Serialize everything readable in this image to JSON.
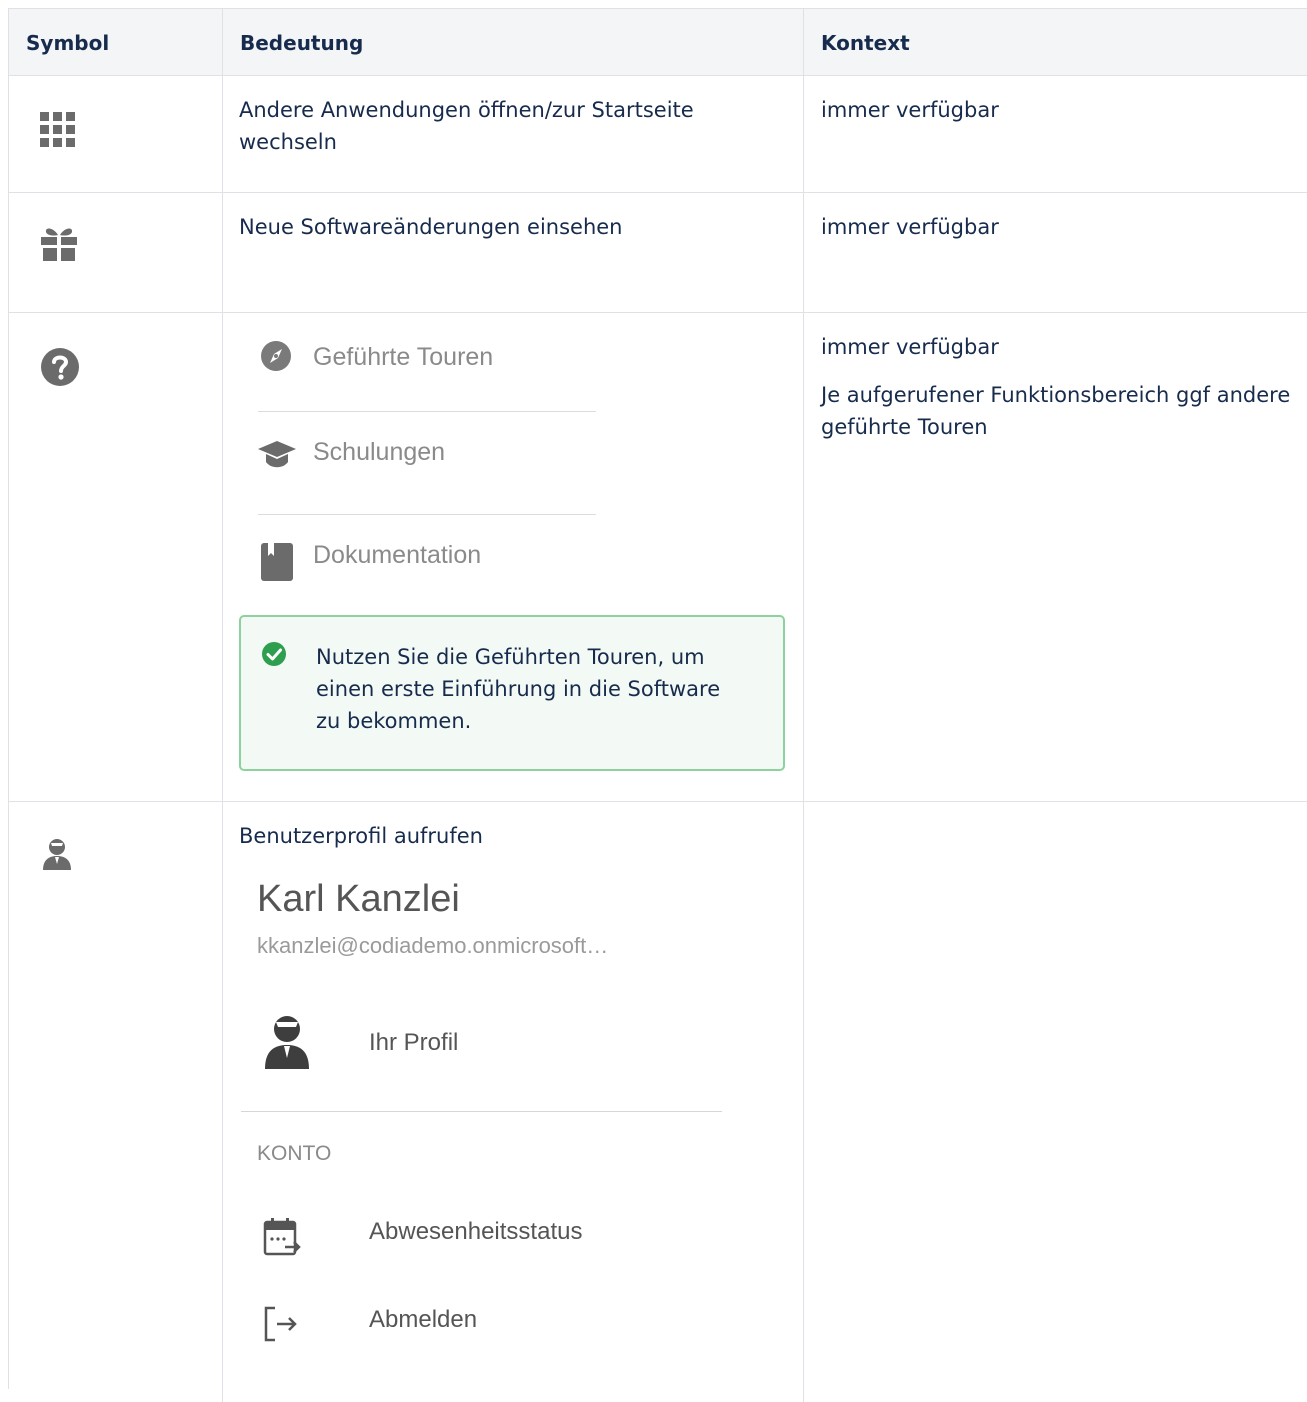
{
  "table": {
    "headers": [
      "Symbol",
      "Bedeutung",
      "Kontext"
    ],
    "rows": [
      {
        "symbol_icon": "apps-grid-icon",
        "meaning": "Andere Anwendungen öffnen/zur Startseite wechseln",
        "context": "immer verfügbar"
      },
      {
        "symbol_icon": "gift-icon",
        "meaning": "Neue Softwareänderungen einsehen",
        "context": "immer verfügbar"
      },
      {
        "symbol_icon": "help-question-icon",
        "menu_items": [
          "Geführte Touren",
          "Schulungen",
          "Dokumentation"
        ],
        "note": "Nutzen Sie die Geführten Touren, um einen erste Einführung in die Software zu bekommen.",
        "context": "immer verfügbar",
        "context_extra": "Je aufgerufener Funktionsbereich ggf andere geführte Touren"
      },
      {
        "symbol_icon": "user-profile-icon",
        "meaning": "Benutzerprofil aufrufen",
        "profile": {
          "name": "Karl Kanzlei",
          "email": "kkanzlei@codiademo.onmicrosoft…",
          "your_profile": "Ihr Profil",
          "section": "KONTO",
          "absence": "Abwesenheitsstatus",
          "logout": "Abmelden"
        },
        "context": ""
      }
    ]
  },
  "colors": {
    "header_bg": "#f4f5f7",
    "border": "#dfe1e6",
    "text": "#172b4d",
    "success": "#2e9e4f",
    "note_bg": "#f3f9f4",
    "note_border": "#8fd19e"
  }
}
